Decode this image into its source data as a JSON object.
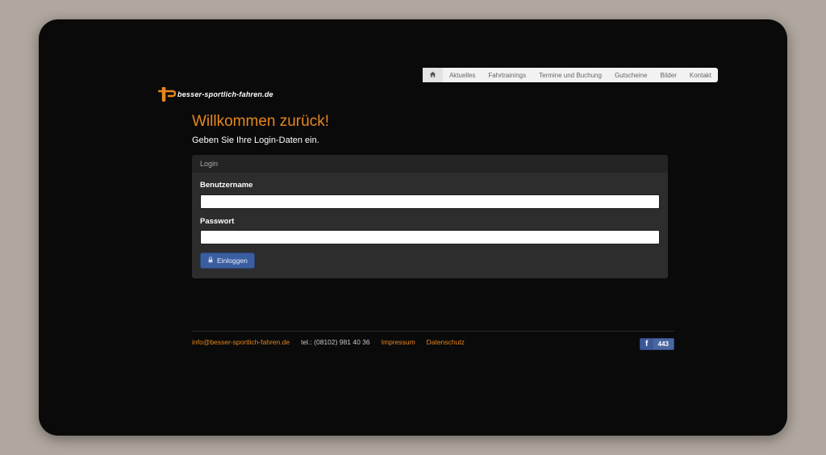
{
  "nav": {
    "home_title": "Home",
    "items": [
      "Aktuelles",
      "Fahrtrainings",
      "Termine und Buchung",
      "Gutscheine",
      "Bilder",
      "Kontakt"
    ]
  },
  "logo": {
    "text": "besser-sportlich-fahren.de"
  },
  "main": {
    "heading": "Willkommen zurück!",
    "subheading": "Geben Sie Ihre Login-Daten ein.",
    "panel_title": "Login",
    "username_label": "Benutzername",
    "password_label": "Passwort",
    "login_button": "Einloggen"
  },
  "footer": {
    "email": "info@besser-sportlich-fahren.de",
    "tel": "tel.: (08102) 981 40 36",
    "impressum": "Impressum",
    "datenschutz": "Datenschutz",
    "fb_count": "443"
  },
  "colors": {
    "accent": "#e8871e",
    "primary_btn": "#3b5ea0",
    "fb": "#3b5998"
  }
}
